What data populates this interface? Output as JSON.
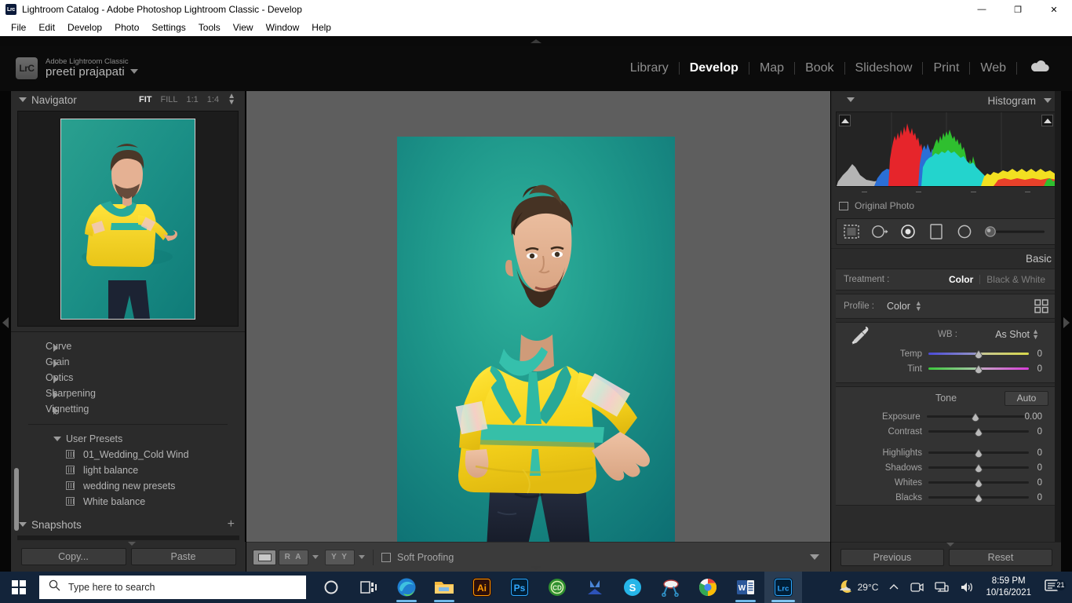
{
  "window": {
    "title": "Lightroom Catalog - Adobe Photoshop Lightroom Classic - Develop",
    "app_badge": "Lrc",
    "minimize": "—",
    "maximize": "❐",
    "close": "✕"
  },
  "menubar": {
    "items": [
      "File",
      "Edit",
      "Develop",
      "Photo",
      "Settings",
      "Tools",
      "View",
      "Window",
      "Help"
    ]
  },
  "identity": {
    "logo": "LrC",
    "product": "Adobe Lightroom Classic",
    "catalog_name": "preeti prajapati"
  },
  "modules": {
    "items": [
      "Library",
      "Develop",
      "Map",
      "Book",
      "Slideshow",
      "Print",
      "Web"
    ],
    "active": "Develop",
    "cloud_icon": "cloud-icon"
  },
  "left_panel": {
    "navigator": {
      "title": "Navigator",
      "zoom_levels": [
        "FIT",
        "FILL",
        "1:1",
        "1:4"
      ],
      "active_zoom": "FIT"
    },
    "collapsed_sections": [
      "Curve",
      "Grain",
      "Optics",
      "Sharpening",
      "Vignetting"
    ],
    "user_presets": {
      "title": "User Presets",
      "items": [
        "01_Wedding_Cold Wind",
        "light balance",
        "wedding new presets",
        "White balance"
      ]
    },
    "snapshots": {
      "title": "Snapshots",
      "add_label": "+"
    },
    "copy_label": "Copy...",
    "paste_label": "Paste"
  },
  "toolbar": {
    "view_loupe": "loupe-view-icon",
    "view_before_after_lr": "R A",
    "view_before_after_tb": "Y Y",
    "soft_proofing_label": "Soft Proofing",
    "soft_proofing_checked": false
  },
  "right_panel": {
    "histogram": {
      "title": "Histogram",
      "original_photo_label": "Original Photo",
      "original_photo_checked": false
    },
    "tools": [
      "crop-overlay-icon",
      "spot-removal-icon",
      "red-eye-icon",
      "graduated-filter-icon",
      "radial-filter-icon",
      "adjustment-brush-icon"
    ],
    "basic": {
      "title": "Basic",
      "treatment_label": "Treatment :",
      "treatment_options": [
        "Color",
        "Black & White"
      ],
      "treatment_active": "Color",
      "profile_label": "Profile :",
      "profile_value": "Color",
      "profile_grid_icon": "profile-browser-icon",
      "wb_label": "WB :",
      "wb_value": "As Shot",
      "eyedropper_icon": "white-balance-selector-icon",
      "white_balance_sliders": [
        {
          "name": "Temp",
          "value": "0",
          "pos": 50,
          "type": "temp"
        },
        {
          "name": "Tint",
          "value": "0",
          "pos": 50,
          "type": "tint"
        }
      ],
      "tone_label": "Tone",
      "auto_label": "Auto",
      "tone_sliders_a": [
        {
          "name": "Exposure",
          "value": "0.00",
          "pos": 50
        },
        {
          "name": "Contrast",
          "value": "0",
          "pos": 50
        }
      ],
      "tone_sliders_b": [
        {
          "name": "Highlights",
          "value": "0",
          "pos": 50
        },
        {
          "name": "Shadows",
          "value": "0",
          "pos": 50
        },
        {
          "name": "Whites",
          "value": "0",
          "pos": 50
        },
        {
          "name": "Blacks",
          "value": "0",
          "pos": 50
        }
      ]
    },
    "previous_label": "Previous",
    "reset_label": "Reset"
  },
  "photo": {
    "description": "Studio portrait of a bearded man in a yellow windbreaker on a teal background",
    "background_color": "#1b8f86",
    "jacket_color": "#f5d520"
  },
  "taskbar": {
    "start_icon": "windows-start-icon",
    "search_icon": "search-icon",
    "search_placeholder": "Type here to search",
    "apps": [
      {
        "name": "cortana-icon",
        "label": "O"
      },
      {
        "name": "task-view-icon",
        "label": ""
      },
      {
        "name": "microsoft-edge-icon",
        "label": "",
        "running": true
      },
      {
        "name": "file-explorer-icon",
        "label": "",
        "running": true
      },
      {
        "name": "adobe-illustrator-icon",
        "label": "Ai"
      },
      {
        "name": "adobe-photoshop-icon",
        "label": "Ps"
      },
      {
        "name": "coreldraw-icon",
        "label": "CD"
      },
      {
        "name": "autodesk-icon",
        "label": ""
      },
      {
        "name": "skype-icon",
        "label": "S"
      },
      {
        "name": "snipping-tool-icon",
        "label": ""
      },
      {
        "name": "google-chrome-icon",
        "label": ""
      },
      {
        "name": "microsoft-word-icon",
        "label": "W",
        "running": true
      },
      {
        "name": "lightroom-classic-icon",
        "label": "Lrc",
        "active": true
      }
    ],
    "tray": {
      "weather_icon": "moon-weather-icon",
      "temperature": "29°C",
      "overflow_icon": "show-hidden-icons-chevron",
      "camera_icon": "camera-icon",
      "network_icon": "network-icon",
      "volume_icon": "volume-icon",
      "time": "8:59 PM",
      "date": "10/16/2021",
      "notification_icon": "notifications-icon",
      "notification_count": "21"
    }
  }
}
